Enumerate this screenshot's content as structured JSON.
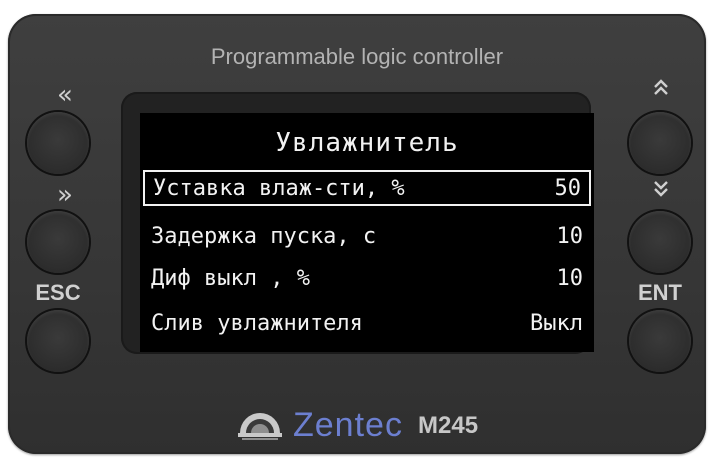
{
  "device": {
    "title": "Programmable logic controller",
    "brand": "Zentec",
    "model": "M245"
  },
  "screen": {
    "title": "Увлажнитель",
    "rows": [
      {
        "label": "Уставка влаж-сти, %",
        "value": "50",
        "selected": true
      },
      {
        "label": "Задержка пуска, с",
        "value": "10"
      },
      {
        "label": "Диф выкл , %",
        "value": "10"
      },
      {
        "label": "Слив увлажнителя",
        "value": "Выкл"
      }
    ]
  },
  "buttons": {
    "left_top_glyph": "«",
    "left_mid_glyph": "»",
    "left_bottom_label": "ESC",
    "right_top_glyph": "⌃⌃",
    "right_mid_glyph": "⌄⌄",
    "right_bottom_label": "ENT"
  },
  "colors": {
    "body": "#363636",
    "screen": "#000000",
    "screen_text": "#f2f2f2",
    "brand": "#6c7fd0"
  },
  "icons": [
    "left-double-arrow-icon",
    "right-double-arrow-icon",
    "up-double-chevron-icon",
    "down-double-chevron-icon",
    "zentec-logo-icon"
  ]
}
